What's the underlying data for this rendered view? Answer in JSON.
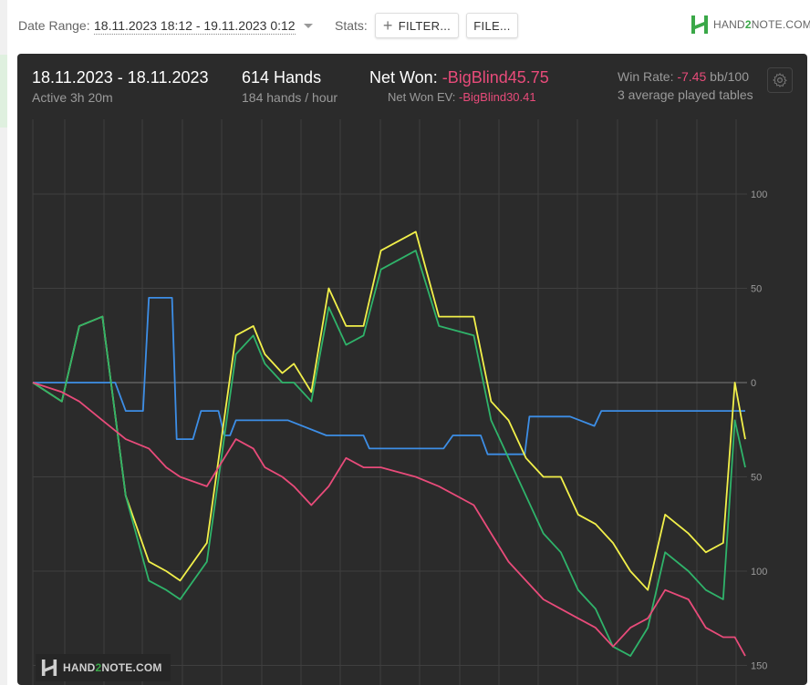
{
  "toolbar": {
    "date_range_label": "Date Range:",
    "date_range_value": "18.11.2023 18:12 - 19.11.2023 0:12",
    "stats_label": "Stats:",
    "filter_label": "FILTER...",
    "file_label": "FILE...",
    "brand_prefix": "HAND",
    "brand_2": "2",
    "brand_suffix": "NOTE.COM"
  },
  "summary": {
    "date": "18.11.2023 - 18.11.2023",
    "active": "Active 3h 20m",
    "hands": "614 Hands",
    "hands_per_hour": "184 hands / hour",
    "net_won_label": "Net Won:",
    "net_won_value": "-BigBlind45.75",
    "net_won_ev_label": "Net Won  EV:",
    "net_won_ev_value": "-BigBlind30.41",
    "win_rate_label": "Win Rate:",
    "win_rate_value": "-7.45",
    "win_rate_unit": "bb/100",
    "tables": "3 average played tables"
  },
  "colors": {
    "blue": "#3d8ee6",
    "yellow": "#f2f04a",
    "green": "#2fb36a",
    "pink": "#e84b7a",
    "panel_bg": "#2b2b2b",
    "grid": "#3f3f3f"
  },
  "chart_data": {
    "type": "line",
    "ylim": [
      -150,
      125
    ],
    "y_ticks": [
      100,
      50,
      0,
      50,
      100,
      150
    ],
    "y_tick_values": [
      100,
      50,
      0,
      -50,
      -100,
      -150
    ],
    "xlim": [
      0,
      614
    ],
    "grid": true,
    "series": [
      {
        "key": "blue",
        "x": [
          0,
          25,
          28,
          71,
          80,
          86,
          92,
          95,
          100,
          104,
          107,
          112,
          117,
          120,
          124,
          128,
          131,
          135,
          138,
          145,
          152,
          160,
          165,
          170,
          175,
          180,
          185,
          188,
          192,
          197,
          199,
          220,
          253,
          260,
          272,
          277,
          285,
          290,
          298,
          310,
          316,
          323,
          328,
          338,
          345,
          354,
          362,
          386,
          392,
          424,
          428,
          437,
          440,
          456,
          463,
          484,
          490,
          500,
          510,
          516,
          523,
          532,
          539,
          552,
          560,
          566,
          572,
          584,
          592,
          600,
          606,
          612,
          614
        ],
        "y": [
          0,
          0,
          0,
          0,
          -15,
          -15,
          -15,
          -15,
          45,
          45,
          45,
          45,
          45,
          45,
          -30,
          -30,
          -30,
          -30,
          -30,
          -15,
          -15,
          -15,
          -28,
          -28,
          -20,
          -20,
          -20,
          -20,
          -20,
          -20,
          -20,
          -20,
          -28,
          -28,
          -28,
          -28,
          -28,
          -35,
          -35,
          -35,
          -35,
          -35,
          -35,
          -35,
          -35,
          -35,
          -28,
          -28,
          -38,
          -38,
          -18,
          -18,
          -18,
          -18,
          -18,
          -23,
          -15,
          -15,
          -15,
          -15,
          -15,
          -15,
          -15,
          -15,
          -15,
          -15,
          -15,
          -15,
          -15,
          -15,
          -15,
          -15,
          -15
        ]
      },
      {
        "key": "yellow",
        "x": [
          0,
          25,
          40,
          60,
          80,
          100,
          115,
          127,
          150,
          175,
          190,
          200,
          215,
          225,
          240,
          255,
          270,
          285,
          300,
          330,
          350,
          380,
          395,
          410,
          425,
          440,
          455,
          470,
          485,
          500,
          515,
          530,
          545,
          565,
          580,
          595,
          605,
          614
        ],
        "y": [
          0,
          -10,
          30,
          35,
          -60,
          -95,
          -100,
          -105,
          -85,
          25,
          30,
          15,
          5,
          10,
          -5,
          50,
          30,
          30,
          70,
          80,
          35,
          35,
          -10,
          -20,
          -40,
          -50,
          -50,
          -70,
          -75,
          -85,
          -100,
          -110,
          -70,
          -80,
          -90,
          -85,
          0,
          -30
        ]
      },
      {
        "key": "green",
        "x": [
          0,
          25,
          40,
          60,
          80,
          100,
          115,
          127,
          150,
          175,
          190,
          200,
          215,
          225,
          240,
          255,
          270,
          285,
          300,
          330,
          350,
          380,
          395,
          410,
          425,
          440,
          455,
          470,
          485,
          500,
          515,
          530,
          545,
          565,
          580,
          595,
          605,
          614
        ],
        "y": [
          0,
          -10,
          30,
          35,
          -60,
          -105,
          -110,
          -115,
          -95,
          15,
          25,
          10,
          0,
          0,
          -10,
          40,
          20,
          25,
          60,
          70,
          30,
          25,
          -20,
          -40,
          -60,
          -80,
          -90,
          -110,
          -120,
          -140,
          -145,
          -130,
          -90,
          -100,
          -110,
          -115,
          -20,
          -45
        ]
      },
      {
        "key": "pink",
        "x": [
          0,
          25,
          40,
          60,
          80,
          100,
          115,
          127,
          150,
          175,
          190,
          200,
          215,
          225,
          240,
          255,
          270,
          285,
          300,
          330,
          350,
          380,
          395,
          410,
          425,
          440,
          455,
          470,
          485,
          500,
          515,
          530,
          545,
          565,
          580,
          595,
          605,
          614
        ],
        "y": [
          0,
          -5,
          -10,
          -20,
          -30,
          -35,
          -45,
          -50,
          -55,
          -30,
          -35,
          -45,
          -50,
          -55,
          -65,
          -55,
          -40,
          -45,
          -45,
          -50,
          -55,
          -65,
          -80,
          -95,
          -105,
          -115,
          -120,
          -125,
          -130,
          -140,
          -130,
          -125,
          -110,
          -115,
          -130,
          -135,
          -135,
          -145
        ]
      }
    ]
  },
  "icons": {
    "gear": "gear-icon",
    "plus": "plus-icon",
    "caret": "chevron-down-icon",
    "logo": "hand2note-logo-icon"
  }
}
